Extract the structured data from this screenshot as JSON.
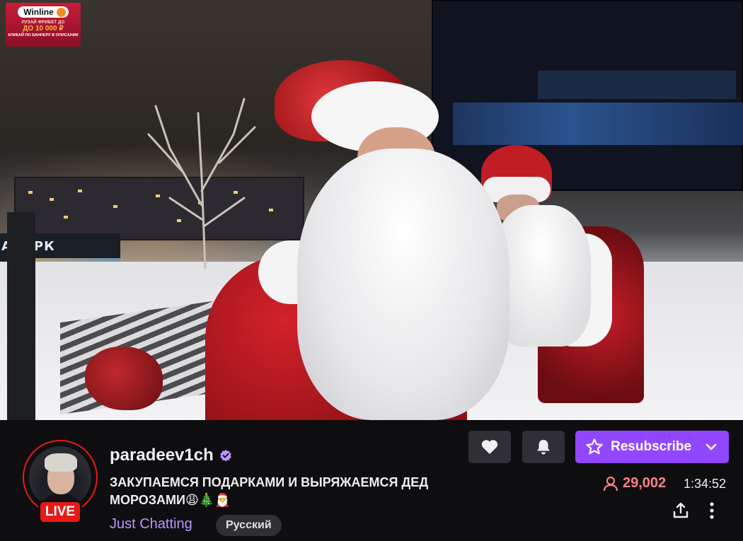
{
  "ad": {
    "brand": "Winline",
    "line1": "ЛУЗАЙ ФРИБЕТ ДО",
    "line2": "ДО 10 000 ₽",
    "line3": "КЛИКАЙ ПО БАННЕРУ В ОПИСАНИИ"
  },
  "video": {
    "sign_text": "АПАРК"
  },
  "channel": {
    "name": "paradeev1ch",
    "verified": true,
    "live_label": "LIVE"
  },
  "stream": {
    "title": "ЗАКУПАЕМСЯ ПОДАРКАМИ И ВЫРЯЖАЕМСЯ ДЕД МОРОЗАМИ😩🎄🎅",
    "category": "Just Chatting",
    "language_tag": "Русский",
    "viewers": "29,002",
    "uptime": "1:34:52"
  },
  "actions": {
    "follow_icon": "heart-icon",
    "notify_icon": "bell-icon",
    "subscribe_label": "Resubscribe",
    "share_icon": "share-icon",
    "more_icon": "more-vertical-icon"
  },
  "colors": {
    "accent": "#9147ff",
    "live": "#e91916",
    "viewers": "#ff8280",
    "category": "#bf94ff",
    "background": "#0e0e10"
  }
}
